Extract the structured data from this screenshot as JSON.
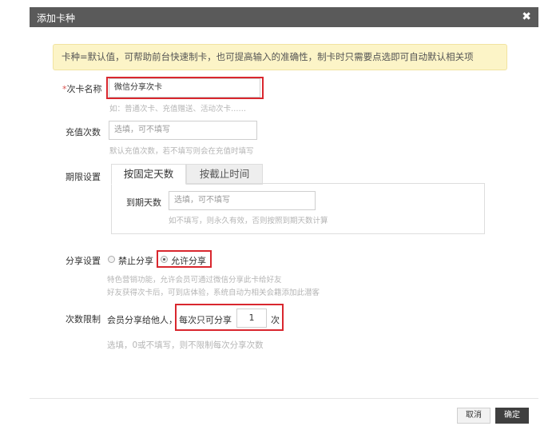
{
  "dialog": {
    "title": "添加卡种",
    "close_glyph": "✖"
  },
  "notice": "卡种=默认值，可帮助前台快速制卡，也可提高输入的准确性，制卡时只需要点选即可自动默认相关项",
  "card_name": {
    "required_mark": "*",
    "label": "次卡名称",
    "value": "微信分享次卡",
    "hint": "如：普通次卡、充值赠送、活动次卡……"
  },
  "recharge": {
    "label": "充值次数",
    "placeholder": "选填，可不填写",
    "hint": "默认充值次数，若不填写则会在充值时填写"
  },
  "period": {
    "label": "期限设置",
    "tabs": [
      {
        "label": "按固定天数"
      },
      {
        "label": "按截止时间"
      }
    ],
    "expire_label": "到期天数",
    "expire_placeholder": "选填，可不填写",
    "expire_hint": "如不填写，则永久有效，否则按照到期天数计算"
  },
  "share": {
    "label": "分享设置",
    "options": [
      {
        "label": "禁止分享",
        "checked": false
      },
      {
        "label": "允许分享",
        "checked": true
      }
    ],
    "hint1": "特色营销功能，允许会员可通过微信分享此卡给好友",
    "hint2": "好友获得次卡后，可到店体验，系统自动为相关会籍添加此潜客"
  },
  "limit": {
    "label": "次数限制",
    "prefix": "会员分享给他人，",
    "mid": "每次只可分享",
    "value": "1",
    "suffix": "次",
    "hint": "选填，0或不填写，则不限制每次分享次数"
  },
  "footer": {
    "cancel": "取消",
    "ok": "确定"
  },
  "colors": {
    "titlebar": "#5a5a5a",
    "notice_bg": "#fcf4c7",
    "highlight": "#d9272e",
    "ok_button": "#3f3f3f"
  }
}
